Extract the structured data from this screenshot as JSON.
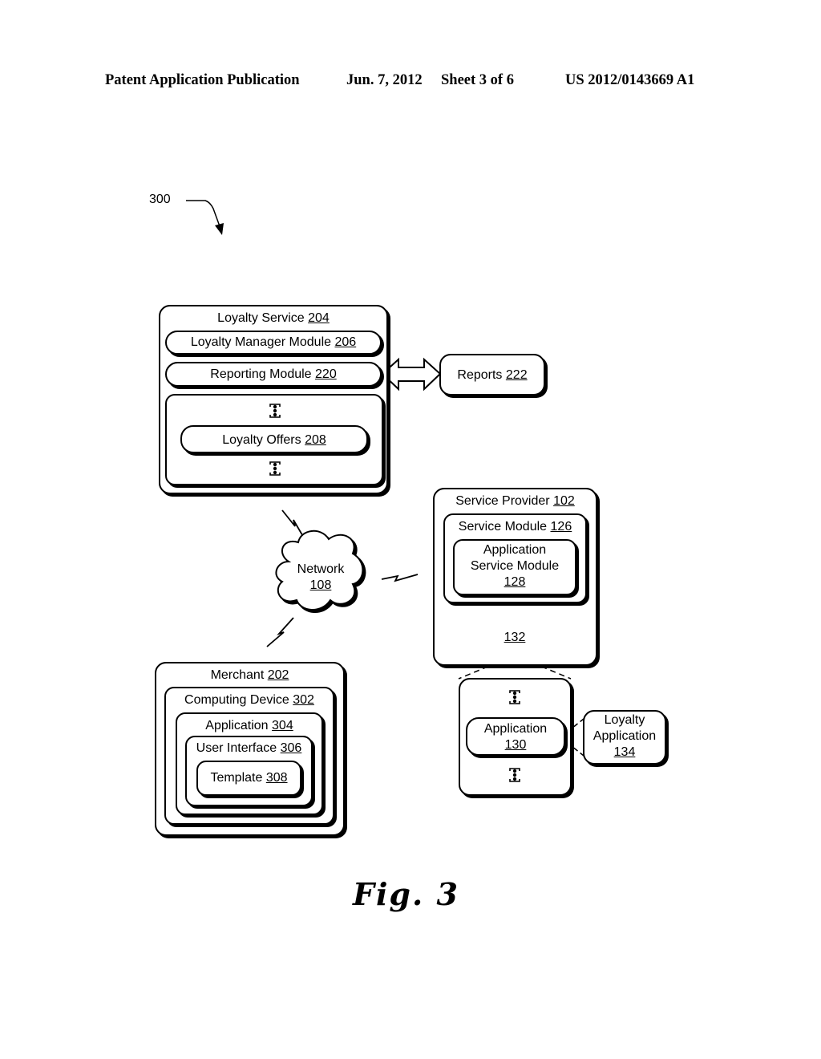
{
  "header": {
    "left": "Patent Application Publication",
    "date": "Jun. 7, 2012",
    "sheet": "Sheet 3 of 6",
    "pub_number": "US 2012/0143669 A1"
  },
  "figure_ref": "300",
  "figure_caption": "Fig. 3",
  "loyalty_service": {
    "title": "Loyalty Service",
    "num": "204",
    "manager": {
      "title": "Loyalty Manager Module",
      "num": "206"
    },
    "reporting": {
      "title": "Reporting Module",
      "num": "220"
    },
    "offers": {
      "title": "Loyalty Offers",
      "num": "208"
    }
  },
  "reports": {
    "title": "Reports",
    "num": "222"
  },
  "network": {
    "title": "Network",
    "num": "108"
  },
  "service_provider": {
    "title": "Service Provider",
    "num": "102",
    "service_module": {
      "title": "Service Module",
      "num": "126"
    },
    "app_service_module": {
      "line1": "Application",
      "line2": "Service Module",
      "num": "128"
    },
    "storage": {
      "num": "132"
    }
  },
  "app_store": {
    "application": {
      "title": "Application",
      "num": "130"
    }
  },
  "loyalty_application": {
    "line1": "Loyalty",
    "line2": "Application",
    "num": "134"
  },
  "merchant": {
    "title": "Merchant",
    "num": "202",
    "computing_device": {
      "title": "Computing Device",
      "num": "302"
    },
    "application": {
      "title": "Application",
      "num": "304"
    },
    "user_interface": {
      "title": "User Interface",
      "num": "306"
    },
    "template": {
      "title": "Template",
      "num": "308"
    }
  }
}
